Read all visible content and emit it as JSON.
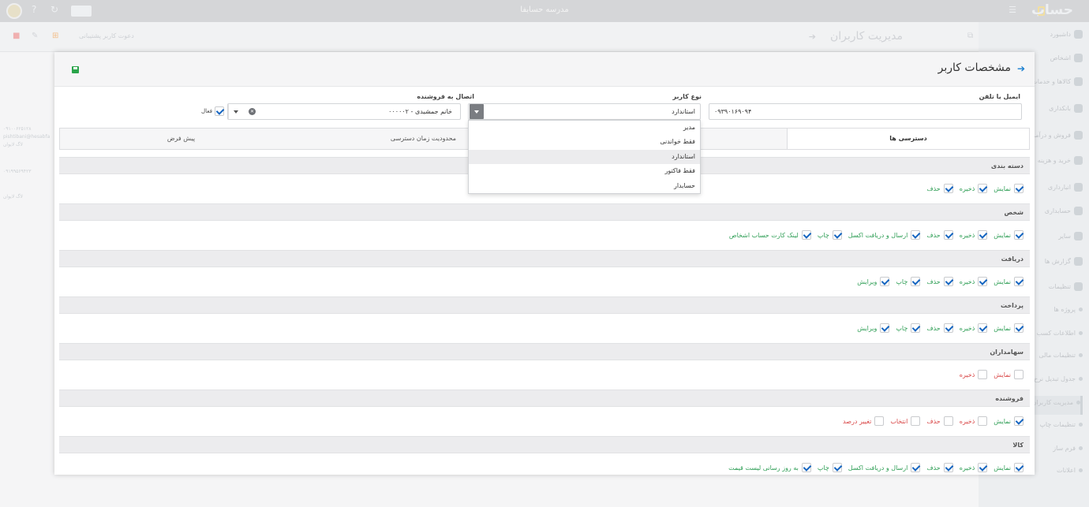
{
  "app": {
    "title": "مدرسه حسابفا",
    "logo": "حساب",
    "icons": {
      "menu": "menu-icon",
      "help": "?",
      "refresh": "↻"
    }
  },
  "sidebar": {
    "items": [
      {
        "label": "داشبورد",
        "icon": "dashboard-icon",
        "top": 0
      },
      {
        "label": "اشخاص",
        "icon": "people-icon"
      },
      {
        "label": "کالاها و خدمات",
        "icon": "box-icon"
      },
      {
        "label": "بانکداری",
        "icon": "bank-icon"
      },
      {
        "label": "فروش و درآمد",
        "icon": "sales-icon"
      },
      {
        "label": "خرید و هزینه",
        "icon": "purchase-icon"
      },
      {
        "label": "انبارداری",
        "icon": "warehouse-icon"
      },
      {
        "label": "حسابداری",
        "icon": "accounting-icon"
      },
      {
        "label": "سایر",
        "icon": "other-icon"
      },
      {
        "label": "گزارش ها",
        "icon": "report-icon"
      },
      {
        "label": "تنظیمات",
        "icon": "settings-icon"
      },
      {
        "label": "پروژه ها",
        "icon": "dot-icon"
      },
      {
        "label": "اطلاعات کسب و کار",
        "icon": "dot-icon"
      },
      {
        "label": "تنظیمات مالی",
        "icon": "dot-icon"
      },
      {
        "label": "جدول تبدیل نرخ ارز",
        "icon": "dot-icon"
      },
      {
        "label": "مدیریت کاربران",
        "icon": "dot-icon"
      },
      {
        "label": "تنظیمات چاپ",
        "icon": "dot-icon"
      },
      {
        "label": "فرم ساز",
        "icon": "dot-icon"
      },
      {
        "label": "اعلانات",
        "icon": "dot-icon"
      }
    ]
  },
  "page": {
    "title": "مدیریت کاربران",
    "invite_label": "دعوت کاربر پشتیبانی",
    "left_list": [
      {
        "phone": "۰۹۱۰۰۶۲۵۱۲۸",
        "email": "pishtibani@hesabfa",
        "status": "لاگ لایوان"
      },
      {
        "phone": "۰۹۱۹۹۵۶۹۴۲۳",
        "status": "لاگ لایوان"
      }
    ]
  },
  "modal": {
    "title": "مشخصات کاربر",
    "fields": {
      "email_label": "ایمیل یا تلفن",
      "email_value": "۰۹۳۹۰۱۶۹۰۹۴",
      "user_type_label": "نوع کاربر",
      "user_type_value": "استاندارد",
      "vendor_label": "اتصال به فروشنده",
      "vendor_value": "۰۰۰۰۰۲ - خانم جمشیدی",
      "active_label": "فعال"
    },
    "dropdown_options": [
      "مدیر",
      "فقط خواندنی",
      "استاندارد",
      "فقط فاکتور",
      "حسابدار"
    ],
    "tabs": [
      "دسترسی ها",
      "",
      "محدودیت زمان دسترسی",
      "پیش فرض"
    ],
    "sections": [
      {
        "title": "دسته بندی",
        "perms": [
          [
            "نمایش",
            true
          ],
          [
            "ذخیره",
            true
          ],
          [
            "حذف",
            true
          ]
        ]
      },
      {
        "title": "شخص",
        "perms": [
          [
            "نمایش",
            true
          ],
          [
            "ذخیره",
            true
          ],
          [
            "حذف",
            true
          ],
          [
            "ارسال و دریافت اکسل",
            true
          ],
          [
            "چاپ",
            true
          ],
          [
            "لینک کارت حساب اشخاص",
            true
          ]
        ]
      },
      {
        "title": "دریافت",
        "perms": [
          [
            "نمایش",
            true
          ],
          [
            "ذخیره",
            true
          ],
          [
            "حذف",
            true
          ],
          [
            "چاپ",
            true
          ],
          [
            "ویرایش",
            true
          ]
        ]
      },
      {
        "title": "پرداخت",
        "perms": [
          [
            "نمایش",
            true
          ],
          [
            "ذخیره",
            true
          ],
          [
            "حذف",
            true
          ],
          [
            "چاپ",
            true
          ],
          [
            "ویرایش",
            true
          ]
        ]
      },
      {
        "title": "سهامداران",
        "perms": [
          [
            "نمایش",
            false
          ],
          [
            "ذخیره",
            false
          ]
        ]
      },
      {
        "title": "فروشنده",
        "perms": [
          [
            "نمایش",
            true
          ],
          [
            "ذخیره",
            false
          ],
          [
            "حذف",
            false
          ],
          [
            "انتخاب",
            false
          ],
          [
            "تغییر درصد",
            false
          ]
        ]
      },
      {
        "title": "کالا",
        "perms": [
          [
            "نمایش",
            true
          ],
          [
            "ذخیره",
            true
          ],
          [
            "حذف",
            true
          ],
          [
            "ارسال و دریافت اکسل",
            true
          ],
          [
            "چاپ",
            true
          ],
          [
            "به روز رسانی لیست قیمت",
            true
          ]
        ]
      }
    ]
  },
  "colors": {
    "accent": "#1a7fd0",
    "green": "#2e9e55",
    "red": "#d94848",
    "check": "#1565c0"
  }
}
